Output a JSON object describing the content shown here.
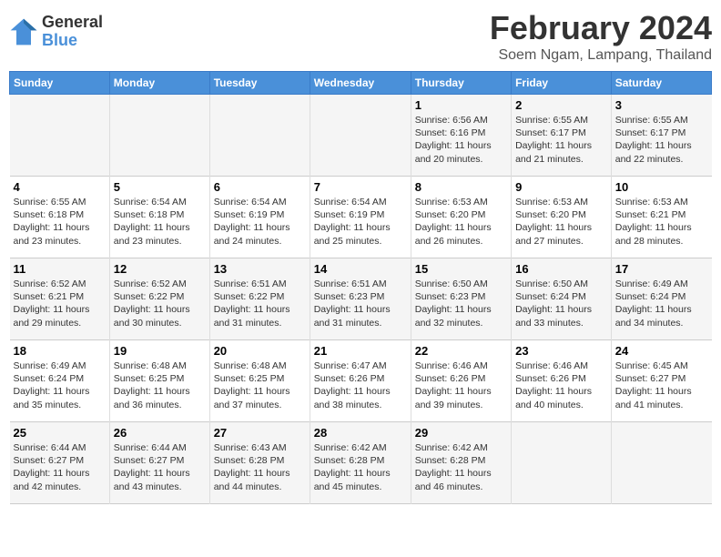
{
  "header": {
    "logo_general": "General",
    "logo_blue": "Blue",
    "month": "February 2024",
    "location": "Soem Ngam, Lampang, Thailand"
  },
  "weekdays": [
    "Sunday",
    "Monday",
    "Tuesday",
    "Wednesday",
    "Thursday",
    "Friday",
    "Saturday"
  ],
  "weeks": [
    [
      {
        "day": "",
        "sunrise": "",
        "sunset": "",
        "daylight": ""
      },
      {
        "day": "",
        "sunrise": "",
        "sunset": "",
        "daylight": ""
      },
      {
        "day": "",
        "sunrise": "",
        "sunset": "",
        "daylight": ""
      },
      {
        "day": "",
        "sunrise": "",
        "sunset": "",
        "daylight": ""
      },
      {
        "day": "1",
        "sunrise": "Sunrise: 6:56 AM",
        "sunset": "Sunset: 6:16 PM",
        "daylight": "Daylight: 11 hours and 20 minutes."
      },
      {
        "day": "2",
        "sunrise": "Sunrise: 6:55 AM",
        "sunset": "Sunset: 6:17 PM",
        "daylight": "Daylight: 11 hours and 21 minutes."
      },
      {
        "day": "3",
        "sunrise": "Sunrise: 6:55 AM",
        "sunset": "Sunset: 6:17 PM",
        "daylight": "Daylight: 11 hours and 22 minutes."
      }
    ],
    [
      {
        "day": "4",
        "sunrise": "Sunrise: 6:55 AM",
        "sunset": "Sunset: 6:18 PM",
        "daylight": "Daylight: 11 hours and 23 minutes."
      },
      {
        "day": "5",
        "sunrise": "Sunrise: 6:54 AM",
        "sunset": "Sunset: 6:18 PM",
        "daylight": "Daylight: 11 hours and 23 minutes."
      },
      {
        "day": "6",
        "sunrise": "Sunrise: 6:54 AM",
        "sunset": "Sunset: 6:19 PM",
        "daylight": "Daylight: 11 hours and 24 minutes."
      },
      {
        "day": "7",
        "sunrise": "Sunrise: 6:54 AM",
        "sunset": "Sunset: 6:19 PM",
        "daylight": "Daylight: 11 hours and 25 minutes."
      },
      {
        "day": "8",
        "sunrise": "Sunrise: 6:53 AM",
        "sunset": "Sunset: 6:20 PM",
        "daylight": "Daylight: 11 hours and 26 minutes."
      },
      {
        "day": "9",
        "sunrise": "Sunrise: 6:53 AM",
        "sunset": "Sunset: 6:20 PM",
        "daylight": "Daylight: 11 hours and 27 minutes."
      },
      {
        "day": "10",
        "sunrise": "Sunrise: 6:53 AM",
        "sunset": "Sunset: 6:21 PM",
        "daylight": "Daylight: 11 hours and 28 minutes."
      }
    ],
    [
      {
        "day": "11",
        "sunrise": "Sunrise: 6:52 AM",
        "sunset": "Sunset: 6:21 PM",
        "daylight": "Daylight: 11 hours and 29 minutes."
      },
      {
        "day": "12",
        "sunrise": "Sunrise: 6:52 AM",
        "sunset": "Sunset: 6:22 PM",
        "daylight": "Daylight: 11 hours and 30 minutes."
      },
      {
        "day": "13",
        "sunrise": "Sunrise: 6:51 AM",
        "sunset": "Sunset: 6:22 PM",
        "daylight": "Daylight: 11 hours and 31 minutes."
      },
      {
        "day": "14",
        "sunrise": "Sunrise: 6:51 AM",
        "sunset": "Sunset: 6:23 PM",
        "daylight": "Daylight: 11 hours and 31 minutes."
      },
      {
        "day": "15",
        "sunrise": "Sunrise: 6:50 AM",
        "sunset": "Sunset: 6:23 PM",
        "daylight": "Daylight: 11 hours and 32 minutes."
      },
      {
        "day": "16",
        "sunrise": "Sunrise: 6:50 AM",
        "sunset": "Sunset: 6:24 PM",
        "daylight": "Daylight: 11 hours and 33 minutes."
      },
      {
        "day": "17",
        "sunrise": "Sunrise: 6:49 AM",
        "sunset": "Sunset: 6:24 PM",
        "daylight": "Daylight: 11 hours and 34 minutes."
      }
    ],
    [
      {
        "day": "18",
        "sunrise": "Sunrise: 6:49 AM",
        "sunset": "Sunset: 6:24 PM",
        "daylight": "Daylight: 11 hours and 35 minutes."
      },
      {
        "day": "19",
        "sunrise": "Sunrise: 6:48 AM",
        "sunset": "Sunset: 6:25 PM",
        "daylight": "Daylight: 11 hours and 36 minutes."
      },
      {
        "day": "20",
        "sunrise": "Sunrise: 6:48 AM",
        "sunset": "Sunset: 6:25 PM",
        "daylight": "Daylight: 11 hours and 37 minutes."
      },
      {
        "day": "21",
        "sunrise": "Sunrise: 6:47 AM",
        "sunset": "Sunset: 6:26 PM",
        "daylight": "Daylight: 11 hours and 38 minutes."
      },
      {
        "day": "22",
        "sunrise": "Sunrise: 6:46 AM",
        "sunset": "Sunset: 6:26 PM",
        "daylight": "Daylight: 11 hours and 39 minutes."
      },
      {
        "day": "23",
        "sunrise": "Sunrise: 6:46 AM",
        "sunset": "Sunset: 6:26 PM",
        "daylight": "Daylight: 11 hours and 40 minutes."
      },
      {
        "day": "24",
        "sunrise": "Sunrise: 6:45 AM",
        "sunset": "Sunset: 6:27 PM",
        "daylight": "Daylight: 11 hours and 41 minutes."
      }
    ],
    [
      {
        "day": "25",
        "sunrise": "Sunrise: 6:44 AM",
        "sunset": "Sunset: 6:27 PM",
        "daylight": "Daylight: 11 hours and 42 minutes."
      },
      {
        "day": "26",
        "sunrise": "Sunrise: 6:44 AM",
        "sunset": "Sunset: 6:27 PM",
        "daylight": "Daylight: 11 hours and 43 minutes."
      },
      {
        "day": "27",
        "sunrise": "Sunrise: 6:43 AM",
        "sunset": "Sunset: 6:28 PM",
        "daylight": "Daylight: 11 hours and 44 minutes."
      },
      {
        "day": "28",
        "sunrise": "Sunrise: 6:42 AM",
        "sunset": "Sunset: 6:28 PM",
        "daylight": "Daylight: 11 hours and 45 minutes."
      },
      {
        "day": "29",
        "sunrise": "Sunrise: 6:42 AM",
        "sunset": "Sunset: 6:28 PM",
        "daylight": "Daylight: 11 hours and 46 minutes."
      },
      {
        "day": "",
        "sunrise": "",
        "sunset": "",
        "daylight": ""
      },
      {
        "day": "",
        "sunrise": "",
        "sunset": "",
        "daylight": ""
      }
    ]
  ]
}
